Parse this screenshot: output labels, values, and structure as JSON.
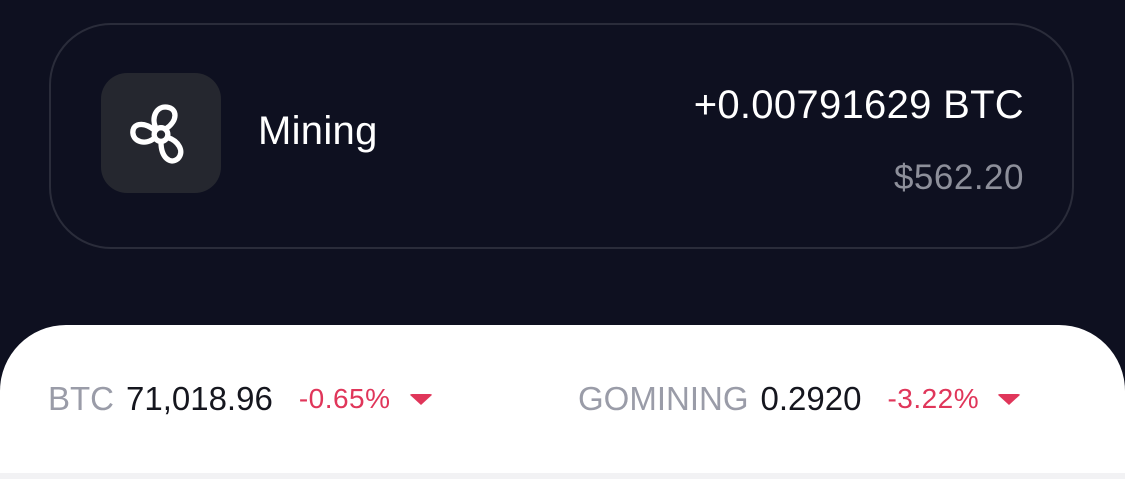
{
  "mining_card": {
    "icon": "fan-icon",
    "label": "Mining",
    "btc_amount": "+0.00791629 BTC",
    "usd_amount": "$562.20"
  },
  "ticker": [
    {
      "symbol": "BTC",
      "price": "71,018.96",
      "change": "-0.65%",
      "direction_icon": "caret-down-icon"
    },
    {
      "symbol": "GOMINING",
      "price": "0.2920",
      "change": "-3.22%",
      "direction_icon": "caret-down-icon"
    }
  ],
  "colors": {
    "background": "#0e1020",
    "card_border": "#2a2c3a",
    "icon_tile": "#25272f",
    "negative": "#e0365a",
    "muted": "#8d8f9a"
  }
}
